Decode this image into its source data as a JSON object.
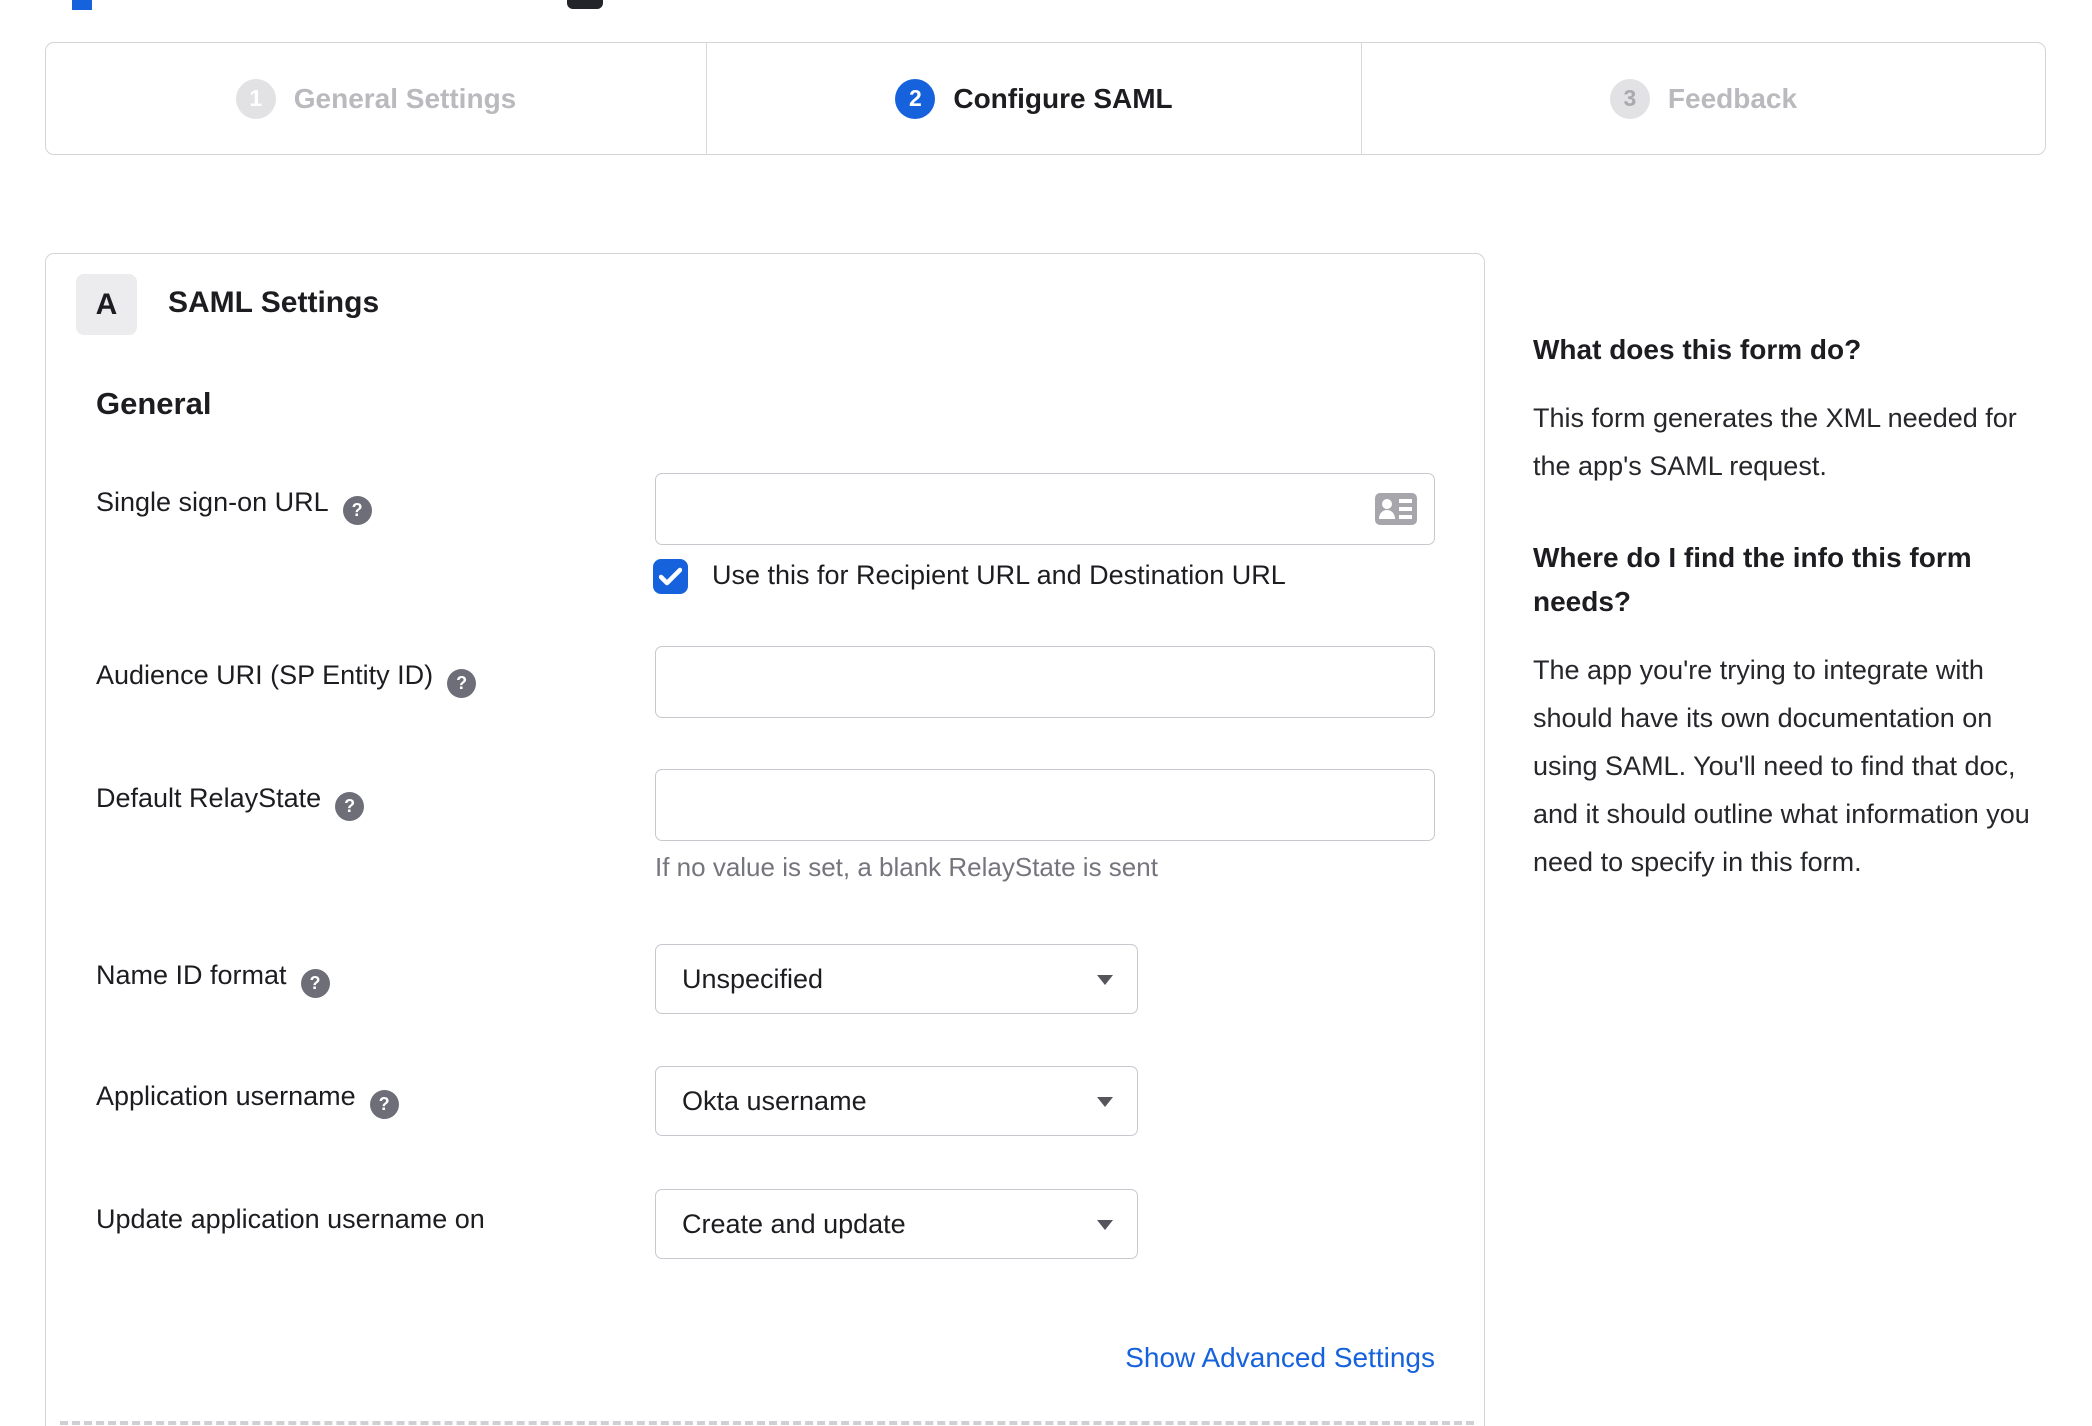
{
  "colors": {
    "accent": "#1662dd",
    "link": "#1662dd",
    "inactive_gray": "#b9b9be"
  },
  "stepper": {
    "steps": [
      {
        "number": "1",
        "label": "General Settings",
        "state": "visited"
      },
      {
        "number": "2",
        "label": "Configure SAML",
        "state": "active"
      },
      {
        "number": "3",
        "label": "Feedback",
        "state": "upcoming"
      }
    ]
  },
  "panel": {
    "badge": "A",
    "title": "SAML Settings",
    "section_title": "General",
    "fields": {
      "sso": {
        "label": "Single sign-on URL",
        "value": ""
      },
      "sso_checkbox": {
        "label": "Use this for Recipient URL and Destination URL",
        "checked": true
      },
      "audience": {
        "label": "Audience URI (SP Entity ID)",
        "value": ""
      },
      "relay": {
        "label": "Default RelayState",
        "value": "",
        "hint": "If no value is set, a blank RelayState is sent"
      },
      "name_id": {
        "label": "Name ID format",
        "value": "Unspecified"
      },
      "app_username": {
        "label": "Application username",
        "value": "Okta username"
      },
      "update_username": {
        "label": "Update application username on",
        "value": "Create and update"
      }
    },
    "advanced_link": "Show Advanced Settings"
  },
  "sidebar": {
    "section1": {
      "heading": "What does this form do?",
      "body": "This form generates the XML needed for the app's SAML request."
    },
    "section2": {
      "heading": "Where do I find the info this form needs?",
      "body": "The app you're trying to integrate with should have its own documentation on using SAML. You'll need to find that doc, and it should outline what information you need to specify in this form."
    }
  }
}
